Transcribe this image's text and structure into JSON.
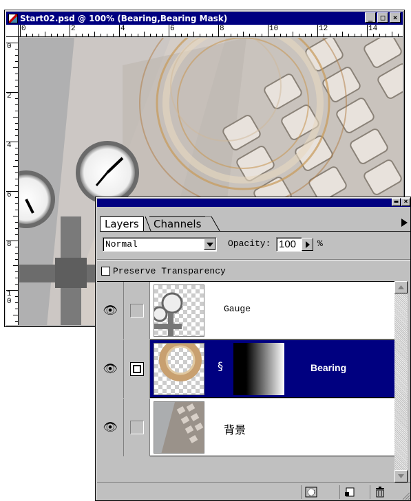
{
  "document_window": {
    "title": "Start02.psd @ 100% (Bearing,Bearing Mask)",
    "buttons": {
      "minimize": "_",
      "maximize": "□",
      "close": "×"
    },
    "ruler_top_labels": [
      "0",
      "2",
      "4",
      "6",
      "8",
      "10",
      "12",
      "14"
    ],
    "ruler_left_labels": [
      "0",
      "2",
      "4",
      "6",
      "8",
      "1\n0"
    ]
  },
  "layers_palette": {
    "buttons": {
      "minimize": "▬",
      "close": "×"
    },
    "tabs": [
      {
        "label": "Layers",
        "active": true
      },
      {
        "label": "Channels",
        "active": false
      }
    ],
    "blend_mode": "Normal",
    "opacity_label": "Opacity:",
    "opacity_value": "100",
    "opacity_unit": "%",
    "preserve_transparency_label": "Preserve Transparency",
    "preserve_transparency_checked": false,
    "layers": [
      {
        "name": "Gauge",
        "visible": true,
        "selected": false,
        "has_mask": false
      },
      {
        "name": "Bearing",
        "visible": true,
        "selected": true,
        "has_mask": true
      },
      {
        "name": "背景",
        "visible": true,
        "selected": false,
        "has_mask": false
      }
    ],
    "bottom_buttons": [
      {
        "icon": "mask-icon"
      },
      {
        "icon": "new-layer-icon"
      },
      {
        "icon": "trash-icon"
      }
    ],
    "colors": {
      "selection": "#000080",
      "face": "#c0c0c0"
    }
  }
}
